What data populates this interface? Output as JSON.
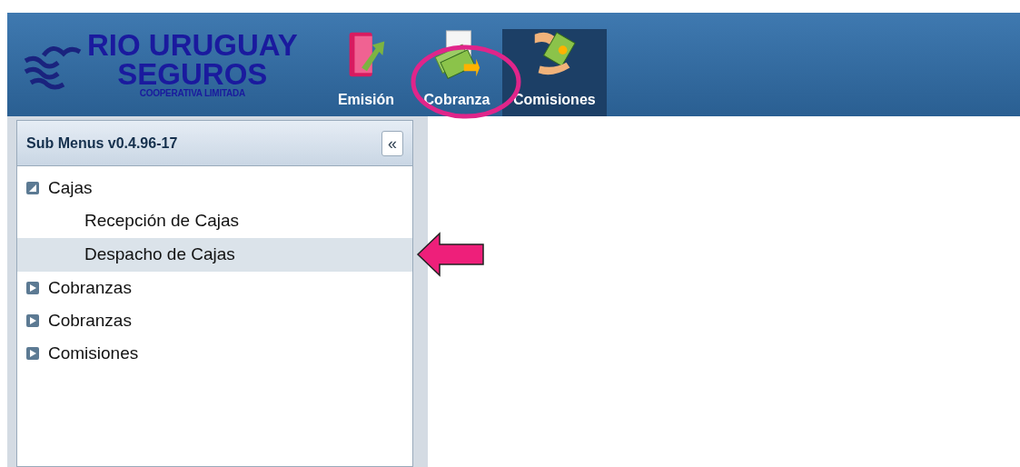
{
  "logo": {
    "line1": "RIO URUGUAY",
    "line2": "SEGUROS",
    "tagline": "COOPERATIVA LIMITADA"
  },
  "modules": [
    {
      "label": "Emisión",
      "selected": false,
      "kind": "folder"
    },
    {
      "label": "Cobranza",
      "selected": false,
      "kind": "money"
    },
    {
      "label": "Comisiones",
      "selected": true,
      "kind": "commission"
    }
  ],
  "sidebar": {
    "title": "Sub Menus v0.4.96-17",
    "collapse_button": "«",
    "tree": [
      {
        "label": "Cajas",
        "expanded": true,
        "selected": false,
        "children": [
          {
            "label": "Recepción de Cajas",
            "selected": false
          },
          {
            "label": "Despacho de Cajas",
            "selected": true
          }
        ]
      },
      {
        "label": "Cobranzas",
        "expanded": false,
        "selected": false
      },
      {
        "label": "Cobranzas",
        "expanded": false,
        "selected": false
      },
      {
        "label": "Comisiones",
        "expanded": false,
        "selected": false
      }
    ]
  }
}
